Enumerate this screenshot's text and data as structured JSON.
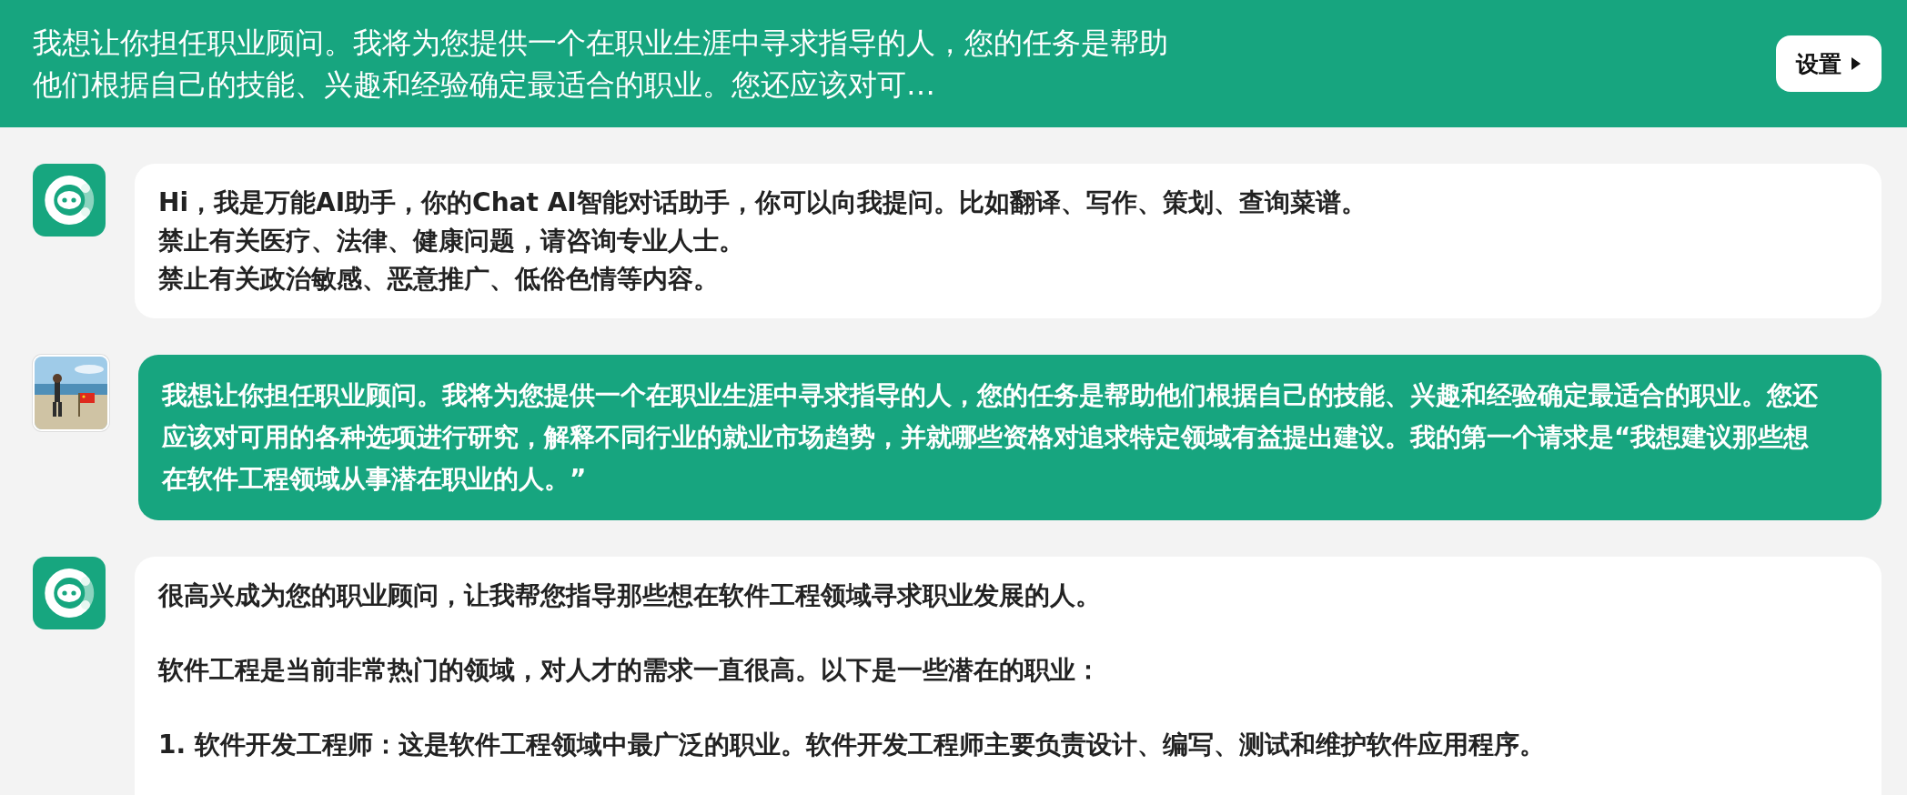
{
  "header": {
    "title": "我想让你担任职业顾问。我将为您提供一个在职业生涯中寻求指导的人，您的任务是帮助他们根据自己的技能、兴趣和经验确定最适合的职业。您还应该对可…",
    "settings_button": "设置"
  },
  "messages": [
    {
      "kind": "assistant",
      "lines": [
        "Hi，我是万能AI助手，你的Chat AI智能对话助手，你可以向我提问。比如翻译、写作、策划、查询菜谱。",
        "禁止有关医疗、法律、健康问题，请咨询专业人士。",
        "禁止有关政治敏感、恶意推广、低俗色情等内容。"
      ]
    },
    {
      "kind": "user",
      "lines": [
        "我想让你担任职业顾问。我将为您提供一个在职业生涯中寻求指导的人，您的任务是帮助他们根据自己的技能、兴趣和经验确定最适合的职业。您还应该对可用的各种选项进行研究，解释不同行业的就业市场趋势，并就哪些资格对追求特定领域有益提出建议。我的第一个请求是“我想建议那些想在软件工程领域从事潜在职业的人。”"
      ]
    },
    {
      "kind": "assistant",
      "paragraphs": [
        "很高兴成为您的职业顾问，让我帮您指导那些想在软件工程领域寻求职业发展的人。",
        "软件工程是当前非常热门的领域，对人才的需求一直很高。以下是一些潜在的职业：",
        "1. 软件开发工程师：这是软件工程领域中最广泛的职业。软件开发工程师主要负责设计、编写、测试和维护软件应用程序。"
      ]
    }
  ]
}
